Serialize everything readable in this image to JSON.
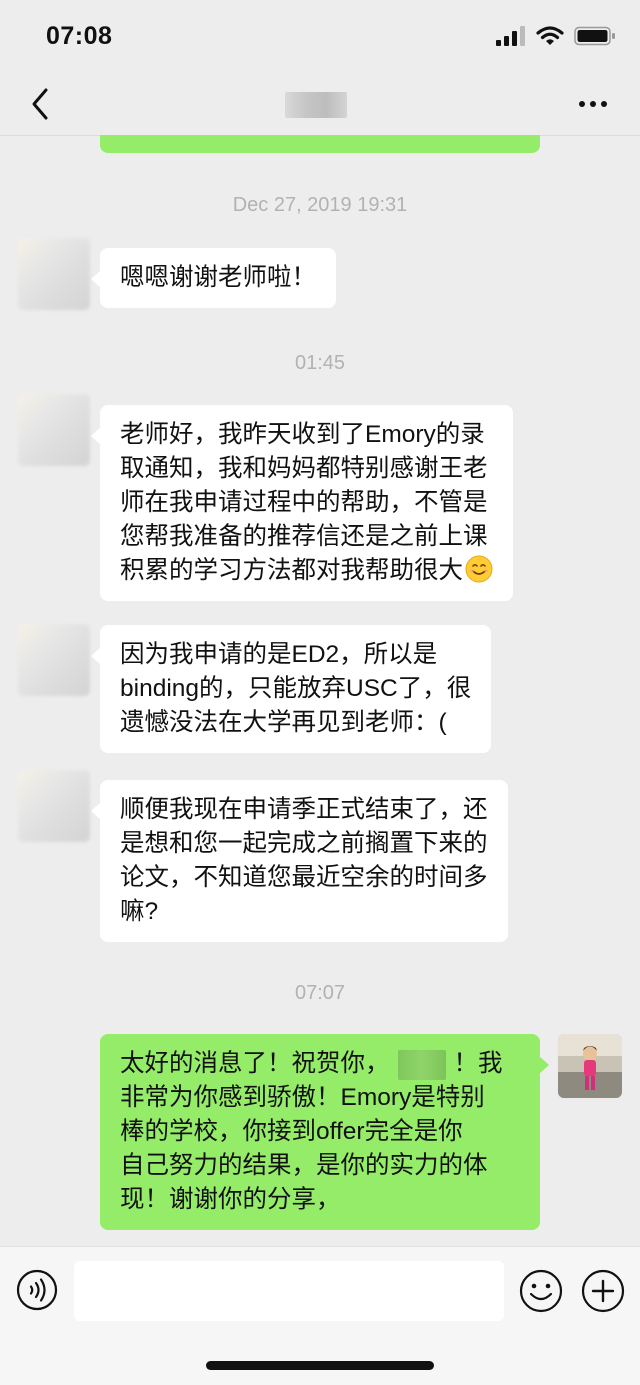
{
  "status_bar": {
    "time": "07:08"
  },
  "header": {
    "back_icon": "chevron-left-icon",
    "more_icon": "more-horizontal-icon"
  },
  "timestamps": [
    "Dec 27, 2019 19:31",
    "01:45",
    "07:07"
  ],
  "messages": [
    {
      "side": "incoming",
      "lines": [
        "嗯嗯谢谢老师啦！"
      ]
    },
    {
      "side": "incoming",
      "lines": [
        "老师好，我昨天收到了Emory的录",
        "取通知，我和妈妈都特别感谢王老",
        "师在我申请过程中的帮助，不管是",
        "您帮我准备的推荐信还是之前上课",
        "积累的学习方法都对我帮助很大"
      ],
      "trailing_icon": "smiling-face-emoji"
    },
    {
      "side": "incoming",
      "lines": [
        "因为我申请的是ED2，所以是",
        "binding的，只能放弃USC了，很",
        "遗憾没法在大学再见到老师：("
      ]
    },
    {
      "side": "incoming",
      "lines": [
        "顺便我现在申请季正式结束了，还",
        "是想和您一起完成之前搁置下来的",
        "论文，不知道您最近空余的时间多",
        "嘛?"
      ]
    },
    {
      "side": "outgoing",
      "line1_before": "太好的消息了！祝贺你，",
      "line1_after": "！我",
      "lines": [
        "非常为你感到骄傲！Emory是特别",
        "棒的学校，你接到offer完全是你",
        "自己努力的结果，是你的实力的体",
        "现！谢谢你的分享，"
      ]
    }
  ],
  "input_bar": {
    "input_value": "",
    "voice_icon": "voice-icon",
    "emoji_icon": "emoji-icon",
    "plus_icon": "plus-circle-icon"
  },
  "colors": {
    "background": "#ededed",
    "outgoing_bubble": "#95ec69",
    "incoming_bubble": "#ffffff",
    "timestamp_text": "#b2b2b2"
  }
}
